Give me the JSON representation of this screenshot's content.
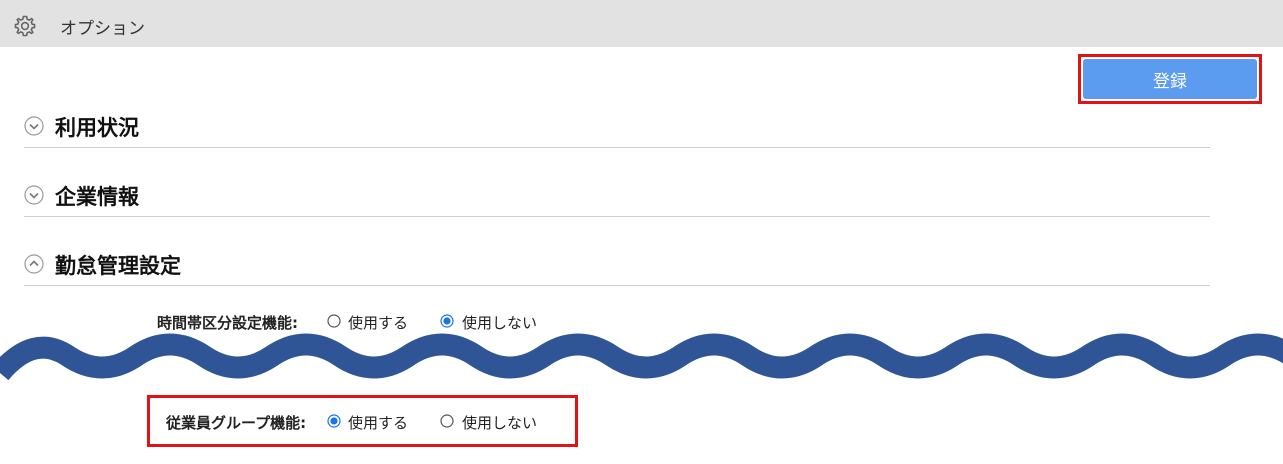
{
  "topbar": {
    "title": "オプション",
    "icon": "gear-icon"
  },
  "toolbar": {
    "save_label": "登録"
  },
  "sections": [
    {
      "title": "利用状況",
      "expanded": false
    },
    {
      "title": "企業情報",
      "expanded": false
    },
    {
      "title": "勤怠管理設定",
      "expanded": true
    }
  ],
  "settings": {
    "time_zone": {
      "label": "時間帯区分設定機能:",
      "options": [
        "使用する",
        "使用しない"
      ],
      "selected": "使用しない"
    },
    "employee_group": {
      "label": "従業員グループ機能:",
      "options": [
        "使用する",
        "使用しない"
      ],
      "selected": "使用する"
    }
  },
  "colors": {
    "accent": "#5b9cf0",
    "highlight": "#e01414",
    "wave": "#2f5597"
  }
}
